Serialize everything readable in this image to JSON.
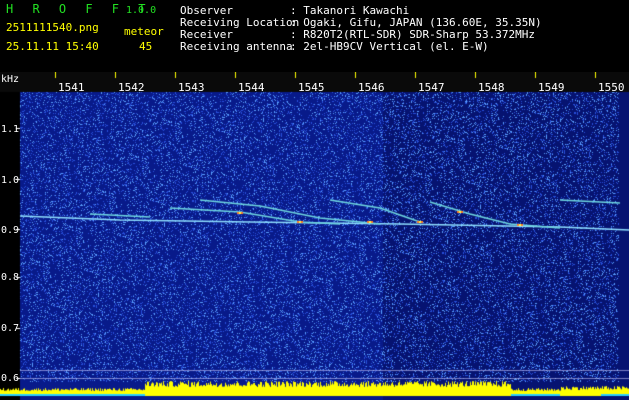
{
  "app": {
    "logo": "H R O F F T",
    "version": "1.0.0"
  },
  "file": {
    "name": "2511111540.png",
    "datetime": "25.11.11 15:40"
  },
  "counter": {
    "label": "meteor",
    "value": "45"
  },
  "info": [
    {
      "key": "Observer",
      "value": ": Takanori Kawachi"
    },
    {
      "key": "Receiving Location",
      "value": ": Ogaki, Gifu, JAPAN (136.60E, 35.35N)"
    },
    {
      "key": "Receiver",
      "value": ": R820T2(RTL-SDR) SDR-Sharp 53.372MHz"
    },
    {
      "key": "Receiving antenna",
      "value": ": 2el-HB9CV Vertical (el. E-W)"
    }
  ],
  "axis": {
    "y_unit": "kHz",
    "y_ticks": [
      "1.1",
      "1.0",
      "0.9",
      "0.8",
      "0.7",
      "0.6"
    ],
    "x_ticks": [
      "1541",
      "1542",
      "1543",
      "1544",
      "1545",
      "1546",
      "1547",
      "1548",
      "1549",
      "1550"
    ]
  },
  "colors": {
    "background": "#000000",
    "spectrum": "#0a1a8c",
    "signal": "#ffff00",
    "text_green": "#22e022",
    "text_yellow": "#ffff00"
  }
}
